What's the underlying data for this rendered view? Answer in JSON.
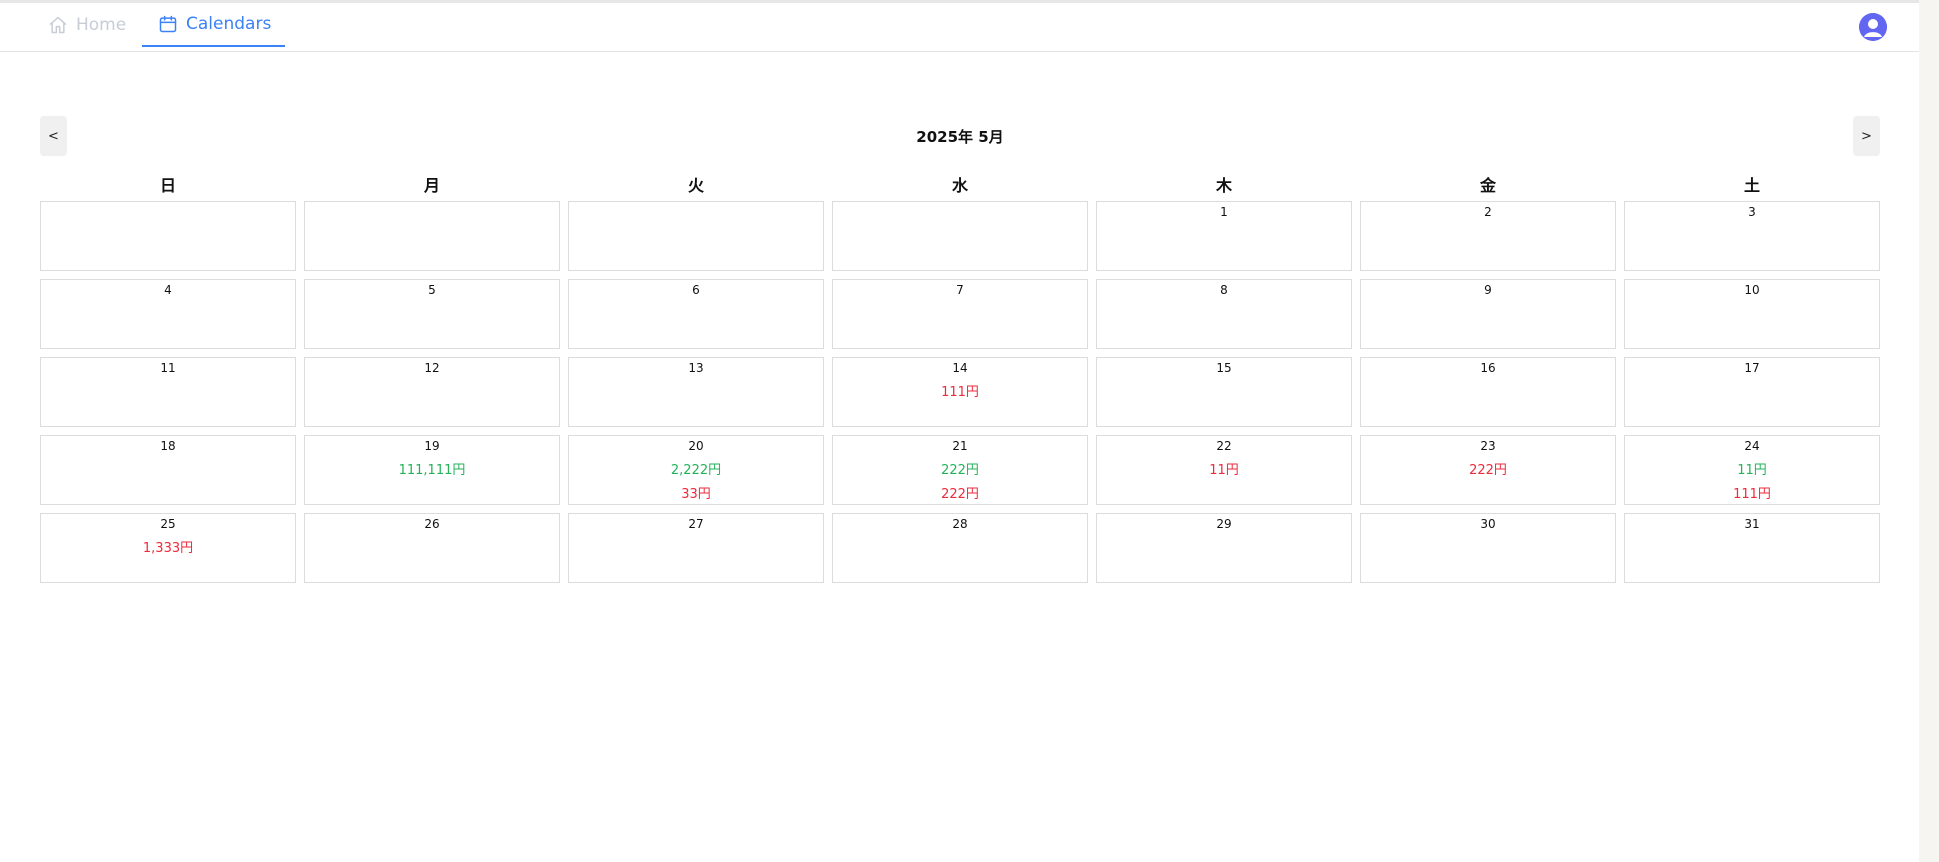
{
  "nav": {
    "home_label": "Home",
    "calendars_label": "Calendars"
  },
  "calendar": {
    "title": "2025年 5月",
    "prev_label": "<",
    "next_label": ">",
    "weekdays": [
      "日",
      "月",
      "火",
      "水",
      "木",
      "金",
      "土"
    ],
    "weeks": [
      [
        {
          "date": "",
          "amounts": []
        },
        {
          "date": "",
          "amounts": []
        },
        {
          "date": "",
          "amounts": []
        },
        {
          "date": "",
          "amounts": []
        },
        {
          "date": "1",
          "amounts": []
        },
        {
          "date": "2",
          "amounts": []
        },
        {
          "date": "3",
          "amounts": []
        }
      ],
      [
        {
          "date": "4",
          "amounts": []
        },
        {
          "date": "5",
          "amounts": []
        },
        {
          "date": "6",
          "amounts": []
        },
        {
          "date": "7",
          "amounts": []
        },
        {
          "date": "8",
          "amounts": []
        },
        {
          "date": "9",
          "amounts": []
        },
        {
          "date": "10",
          "amounts": []
        }
      ],
      [
        {
          "date": "11",
          "amounts": []
        },
        {
          "date": "12",
          "amounts": []
        },
        {
          "date": "13",
          "amounts": []
        },
        {
          "date": "14",
          "amounts": [
            {
              "text": "111円",
              "kind": "expense"
            }
          ]
        },
        {
          "date": "15",
          "amounts": []
        },
        {
          "date": "16",
          "amounts": []
        },
        {
          "date": "17",
          "amounts": []
        }
      ],
      [
        {
          "date": "18",
          "amounts": []
        },
        {
          "date": "19",
          "amounts": [
            {
              "text": "111,111円",
              "kind": "income"
            }
          ]
        },
        {
          "date": "20",
          "amounts": [
            {
              "text": "2,222円",
              "kind": "income"
            },
            {
              "text": "33円",
              "kind": "expense"
            }
          ]
        },
        {
          "date": "21",
          "amounts": [
            {
              "text": "222円",
              "kind": "income"
            },
            {
              "text": "222円",
              "kind": "expense"
            }
          ]
        },
        {
          "date": "22",
          "amounts": [
            {
              "text": "11円",
              "kind": "expense"
            }
          ]
        },
        {
          "date": "23",
          "amounts": [
            {
              "text": "222円",
              "kind": "expense"
            }
          ]
        },
        {
          "date": "24",
          "amounts": [
            {
              "text": "11円",
              "kind": "income"
            },
            {
              "text": "111円",
              "kind": "expense"
            }
          ]
        }
      ],
      [
        {
          "date": "25",
          "amounts": [
            {
              "text": "1,333円",
              "kind": "expense"
            }
          ]
        },
        {
          "date": "26",
          "amounts": []
        },
        {
          "date": "27",
          "amounts": []
        },
        {
          "date": "28",
          "amounts": []
        },
        {
          "date": "29",
          "amounts": []
        },
        {
          "date": "30",
          "amounts": []
        },
        {
          "date": "31",
          "amounts": []
        }
      ]
    ]
  },
  "colors": {
    "accent": "#3b82f6",
    "income": "#22b35a",
    "expense": "#ee2a3c",
    "avatar": "#6366f1"
  },
  "icons": {
    "home": "home-icon",
    "calendars": "calendar-icon",
    "avatar": "user-avatar-icon"
  }
}
